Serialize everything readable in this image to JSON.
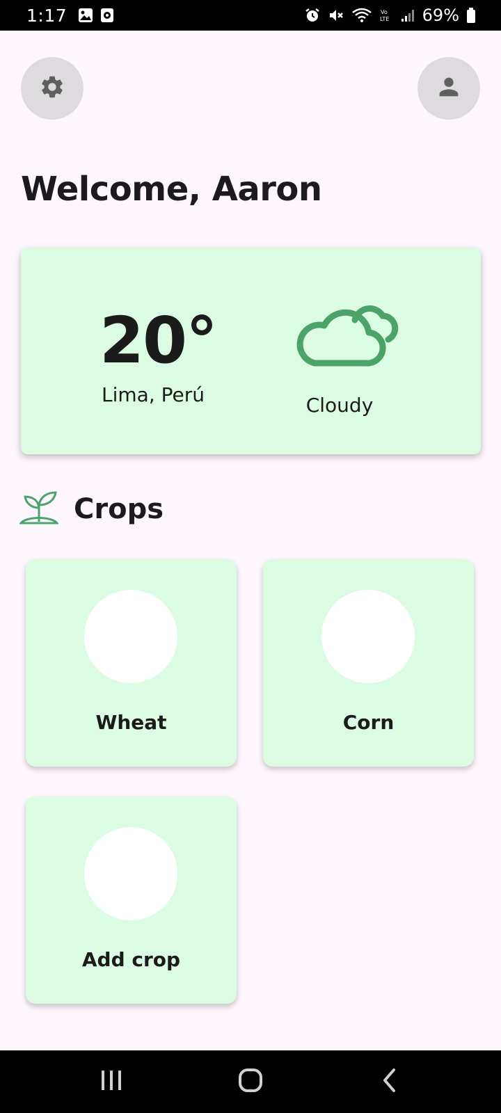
{
  "status_bar": {
    "time": "1:17",
    "battery": "69%",
    "icons": [
      "gallery-icon",
      "screen-record-icon",
      "alarm-icon",
      "mute-icon",
      "wifi-icon",
      "volte-icon",
      "signal-icon",
      "battery-icon"
    ]
  },
  "header": {
    "settings_icon": "gear-icon",
    "profile_icon": "person-icon"
  },
  "welcome": "Welcome, Aaron",
  "weather": {
    "temperature": "20°",
    "location": "Lima, Perú",
    "condition": "Cloudy",
    "icon": "cloud-icon"
  },
  "crops": {
    "title": "Crops",
    "icon": "sprout-icon",
    "items": [
      {
        "label": "Wheat"
      },
      {
        "label": "Corn"
      },
      {
        "label": "Add crop"
      }
    ]
  },
  "nav": {
    "recents": "recents-icon",
    "home": "home-icon",
    "back": "back-icon"
  },
  "colors": {
    "background": "#fdf7fd",
    "card": "#dbfce3",
    "accent_green": "#4ca36a",
    "icon_button_bg": "#dedbdf"
  }
}
